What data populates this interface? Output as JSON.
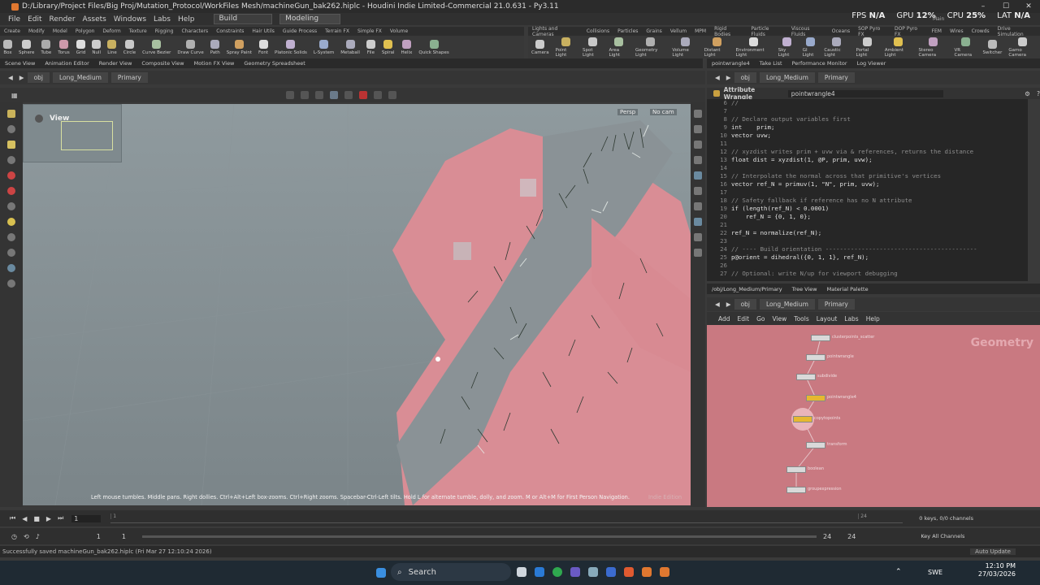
{
  "window": {
    "title": "D:/Library/Project Files/Big Proj/Mutation_Protocol/WorkFiles Mesh/machineGun_bak262.hiplc - Houdini Indie Limited-Commercial 21.0.631 - Py3.11"
  },
  "menu": {
    "items": [
      "File",
      "Edit",
      "Render",
      "Assets",
      "Windows",
      "Labs",
      "Help"
    ],
    "desktop": "Build",
    "desktop2": "Modeling"
  },
  "perf": {
    "fps_label": "FPS",
    "fps": "N/A",
    "gpu_label": "GPU",
    "gpu": "12%",
    "cpu_label": "CPU",
    "cpu": "25%",
    "lat_label": "LAT",
    "lat": "N/A",
    "main_label": "Main"
  },
  "shelf_left": {
    "tabs": [
      "Create",
      "Modify",
      "Model",
      "Polygon",
      "Deform",
      "Texture",
      "Rigging",
      "Characters",
      "Constraints",
      "Hair Utils",
      "Guide Process",
      "Terrain FX",
      "Simple FX",
      "Volume"
    ],
    "tools": [
      "Box",
      "Sphere",
      "Tube",
      "Torus",
      "Grid",
      "Null",
      "Line",
      "Circle",
      "Curve Bezier",
      "Draw Curve",
      "Path",
      "Spray Paint",
      "Font",
      "Platonic Solids",
      "L-System",
      "Metaball",
      "File",
      "Spiral",
      "Helix",
      "Quick Shapes"
    ]
  },
  "shelf_right": {
    "tabs": [
      "Lights and Cameras",
      "Collisions",
      "Particles",
      "Grains",
      "Vellum",
      "MPM",
      "Rigid Bodies",
      "Particle Fluids",
      "Viscous Fluids",
      "Oceans",
      "SOP Pyro FX",
      "DOP Pyro FX",
      "FEM",
      "Wires",
      "Crowds",
      "Drive Simulation"
    ],
    "tools": [
      "Camera",
      "Point Light",
      "Spot Light",
      "Area Light",
      "Geometry Light",
      "Volume Light",
      "Distant Light",
      "Environment Light",
      "Sky Light",
      "GI Light",
      "Caustic Light",
      "Portal Light",
      "Ambient Light",
      "Stereo Camera",
      "VR Camera",
      "Switcher",
      "Gamo Camera"
    ]
  },
  "pane_tabs_left": [
    "Scene View",
    "Animation Editor",
    "Render View",
    "Composite View",
    "Motion FX View",
    "Geometry Spreadsheet"
  ],
  "pane_tabs_right": [
    "pointwrangle4",
    "Take List",
    "Performance Monitor",
    "Log Viewer"
  ],
  "path": {
    "obj": "obj",
    "node": "Long_Medium",
    "net": "Primary"
  },
  "viewport": {
    "label": "View",
    "persp": "Persp",
    "cam": "No cam",
    "hint": "Left mouse tumbles. Middle pans. Right dollies. Ctrl+Alt+Left box-zooms. Ctrl+Right zooms. Spacebar-Ctrl-Left tilts. Hold L for alternate tumble, dolly, and zoom. M or Alt+M for First Person Navigation.",
    "watermark": "Indie Edition"
  },
  "wrangle": {
    "title": "Attribute Wrangle",
    "node": "pointwrangle4"
  },
  "code": [
    {
      "n": "6",
      "t": "//",
      "c": true
    },
    {
      "n": "7",
      "t": "",
      "c": false
    },
    {
      "n": "8",
      "t": "// Declare output variables first",
      "c": true
    },
    {
      "n": "9",
      "t": "int    prim;",
      "c": false
    },
    {
      "n": "10",
      "t": "vector uvw;",
      "c": false
    },
    {
      "n": "11",
      "t": "",
      "c": false
    },
    {
      "n": "12",
      "t": "// xyzdist writes prim + uvw via & references, returns the distance",
      "c": true
    },
    {
      "n": "13",
      "t": "float dist = xyzdist(1, @P, prim, uvw);",
      "c": false
    },
    {
      "n": "14",
      "t": "",
      "c": false
    },
    {
      "n": "15",
      "t": "// Interpolate the normal across that primitive's vertices",
      "c": true
    },
    {
      "n": "16",
      "t": "vector ref_N = primuv(1, \"N\", prim, uvw);",
      "c": false
    },
    {
      "n": "17",
      "t": "",
      "c": false
    },
    {
      "n": "18",
      "t": "// Safety fallback if reference has no N attribute",
      "c": true
    },
    {
      "n": "19",
      "t": "if (length(ref_N) < 0.0001)",
      "c": false
    },
    {
      "n": "20",
      "t": "    ref_N = {0, 1, 0};",
      "c": false
    },
    {
      "n": "21",
      "t": "",
      "c": false
    },
    {
      "n": "22",
      "t": "ref_N = normalize(ref_N);",
      "c": false
    },
    {
      "n": "23",
      "t": "",
      "c": false
    },
    {
      "n": "24",
      "t": "// ---- Build orientation ------------------------------------------",
      "c": true
    },
    {
      "n": "25",
      "t": "p@orient = dihedral({0, 1, 1}, ref_N);",
      "c": false
    },
    {
      "n": "26",
      "t": "",
      "c": false
    },
    {
      "n": "27",
      "t": "// Optional: write N/up for viewport debugging",
      "c": true
    }
  ],
  "net_tabs": [
    "/obj/Long_Medium/Primary",
    "Tree View",
    "Material Palette"
  ],
  "net_menu": [
    "Add",
    "Edit",
    "Go",
    "View",
    "Tools",
    "Layout",
    "Labs",
    "Help"
  ],
  "net_watermark": "Geometry",
  "nodes": [
    "clusterpoints_scatter",
    "pointwrangle",
    "subdivide",
    "pointwrangle4",
    "copytopoints",
    "transform",
    "boolean",
    "groupexpression"
  ],
  "timeline": {
    "frame": "1",
    "start": "1",
    "end": "1",
    "range_end": "24",
    "range_end2": "24",
    "keys": "0 keys, 0/0 channels",
    "key_all": "Key All Channels",
    "auto": "Auto Update",
    "ticks": [
      "1",
      "",
      "",
      "",
      "",
      "",
      "",
      "",
      "",
      "",
      "",
      "",
      "",
      "",
      "",
      "",
      "",
      "",
      "",
      "",
      "",
      "",
      "",
      "24"
    ]
  },
  "status": {
    "text": "Successfully saved machineGun_bak262.hiplc (Fri Mar 27 12:10:24 2026)"
  },
  "taskbar": {
    "search": "Search",
    "lang": "SWE",
    "time": "12:10 PM",
    "date": "27/03/2026"
  }
}
